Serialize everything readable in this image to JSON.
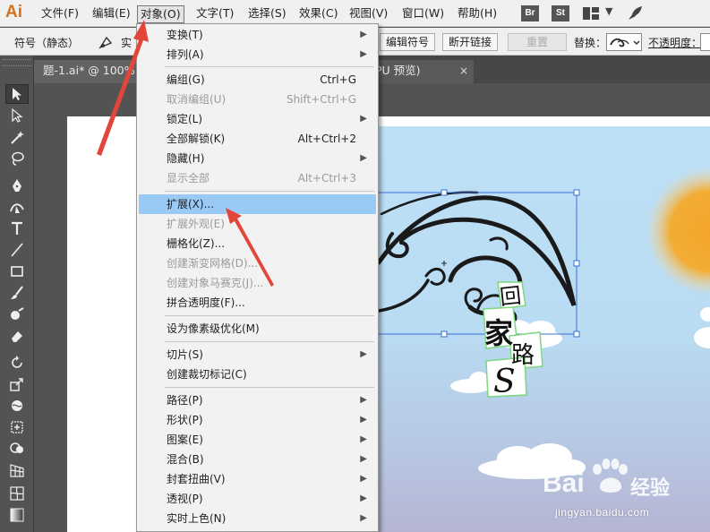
{
  "app": {
    "logo": "Ai"
  },
  "menubar": {
    "items": [
      "文件(F)",
      "编辑(E)",
      "对象(O)",
      "文字(T)",
      "选择(S)",
      "效果(C)",
      "视图(V)",
      "窗口(W)",
      "帮助(H)"
    ],
    "active_index": 2,
    "bridge_label": "Br",
    "stock_label": "St"
  },
  "controlbar": {
    "symbol_label": "符号（静态）",
    "instance_label": "实",
    "edit_symbol": "编辑符号",
    "break_link": "断开链接",
    "reset": "重置",
    "replace_label": "替换：",
    "opacity_label": "不透明度："
  },
  "tabs": [
    {
      "label": "题-1.ai* @ 100% (",
      "close": "×"
    },
    {
      "label": "PU 预览)",
      "close": "×"
    }
  ],
  "object_menu": {
    "items": [
      {
        "label": "变换(T)",
        "shortcut": "",
        "submenu": true,
        "disabled": false
      },
      {
        "label": "排列(A)",
        "shortcut": "",
        "submenu": true,
        "disabled": false
      },
      {
        "label": "编组(G)",
        "shortcut": "Ctrl+G",
        "submenu": false,
        "disabled": false
      },
      {
        "label": "取消编组(U)",
        "shortcut": "Shift+Ctrl+G",
        "submenu": false,
        "disabled": true
      },
      {
        "label": "锁定(L)",
        "shortcut": "",
        "submenu": true,
        "disabled": false
      },
      {
        "label": "全部解锁(K)",
        "shortcut": "Alt+Ctrl+2",
        "submenu": false,
        "disabled": false
      },
      {
        "label": "隐藏(H)",
        "shortcut": "",
        "submenu": true,
        "disabled": false
      },
      {
        "label": "显示全部",
        "shortcut": "Alt+Ctrl+3",
        "submenu": false,
        "disabled": true
      },
      {
        "label": "扩展(X)...",
        "shortcut": "",
        "submenu": false,
        "disabled": false,
        "highlighted": true
      },
      {
        "label": "扩展外观(E)",
        "shortcut": "",
        "submenu": false,
        "disabled": true
      },
      {
        "label": "栅格化(Z)...",
        "shortcut": "",
        "submenu": false,
        "disabled": false
      },
      {
        "label": "创建渐变网格(D)...",
        "shortcut": "",
        "submenu": false,
        "disabled": true
      },
      {
        "label": "创建对象马赛克(J)...",
        "shortcut": "",
        "submenu": false,
        "disabled": true
      },
      {
        "label": "拼合透明度(F)...",
        "shortcut": "",
        "submenu": false,
        "disabled": false
      },
      {
        "label": "设为像素级优化(M)",
        "shortcut": "",
        "submenu": false,
        "disabled": false
      },
      {
        "label": "切片(S)",
        "shortcut": "",
        "submenu": true,
        "disabled": false
      },
      {
        "label": "创建裁切标记(C)",
        "shortcut": "",
        "submenu": false,
        "disabled": false
      },
      {
        "label": "路径(P)",
        "shortcut": "",
        "submenu": true,
        "disabled": false
      },
      {
        "label": "形状(P)",
        "shortcut": "",
        "submenu": true,
        "disabled": false
      },
      {
        "label": "图案(E)",
        "shortcut": "",
        "submenu": true,
        "disabled": false
      },
      {
        "label": "混合(B)",
        "shortcut": "",
        "submenu": true,
        "disabled": false
      },
      {
        "label": "封套扭曲(V)",
        "shortcut": "",
        "submenu": true,
        "disabled": false
      },
      {
        "label": "透视(P)",
        "shortcut": "",
        "submenu": true,
        "disabled": false
      },
      {
        "label": "实时上色(N)",
        "shortcut": "",
        "submenu": true,
        "disabled": false
      }
    ]
  },
  "artwork": {
    "characters": [
      "回",
      "家",
      "路",
      "S"
    ]
  },
  "watermark": {
    "brand": "Bai",
    "brand_cn": "经验",
    "url": "jingyan.baidu.com"
  },
  "colors": {
    "highlight": "#99c9f5",
    "arrow": "#e2463a",
    "sun": "#f2a72c",
    "selection": "#3b6fd6"
  }
}
